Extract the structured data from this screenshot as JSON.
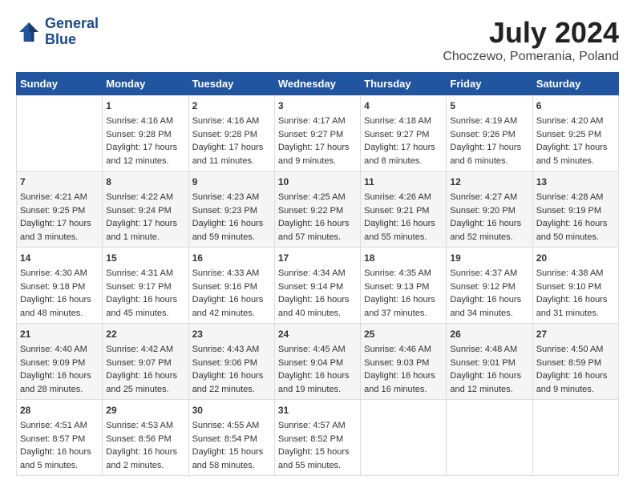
{
  "header": {
    "logo": {
      "line1": "General",
      "line2": "Blue"
    },
    "title": "July 2024",
    "location": "Choczewo, Pomerania, Poland"
  },
  "weekdays": [
    "Sunday",
    "Monday",
    "Tuesday",
    "Wednesday",
    "Thursday",
    "Friday",
    "Saturday"
  ],
  "weeks": [
    [
      {
        "day": "",
        "sunrise": "",
        "sunset": "",
        "daylight": ""
      },
      {
        "day": "1",
        "sunrise": "Sunrise: 4:16 AM",
        "sunset": "Sunset: 9:28 PM",
        "daylight": "Daylight: 17 hours and 12 minutes."
      },
      {
        "day": "2",
        "sunrise": "Sunrise: 4:16 AM",
        "sunset": "Sunset: 9:28 PM",
        "daylight": "Daylight: 17 hours and 11 minutes."
      },
      {
        "day": "3",
        "sunrise": "Sunrise: 4:17 AM",
        "sunset": "Sunset: 9:27 PM",
        "daylight": "Daylight: 17 hours and 9 minutes."
      },
      {
        "day": "4",
        "sunrise": "Sunrise: 4:18 AM",
        "sunset": "Sunset: 9:27 PM",
        "daylight": "Daylight: 17 hours and 8 minutes."
      },
      {
        "day": "5",
        "sunrise": "Sunrise: 4:19 AM",
        "sunset": "Sunset: 9:26 PM",
        "daylight": "Daylight: 17 hours and 6 minutes."
      },
      {
        "day": "6",
        "sunrise": "Sunrise: 4:20 AM",
        "sunset": "Sunset: 9:25 PM",
        "daylight": "Daylight: 17 hours and 5 minutes."
      }
    ],
    [
      {
        "day": "7",
        "sunrise": "Sunrise: 4:21 AM",
        "sunset": "Sunset: 9:25 PM",
        "daylight": "Daylight: 17 hours and 3 minutes."
      },
      {
        "day": "8",
        "sunrise": "Sunrise: 4:22 AM",
        "sunset": "Sunset: 9:24 PM",
        "daylight": "Daylight: 17 hours and 1 minute."
      },
      {
        "day": "9",
        "sunrise": "Sunrise: 4:23 AM",
        "sunset": "Sunset: 9:23 PM",
        "daylight": "Daylight: 16 hours and 59 minutes."
      },
      {
        "day": "10",
        "sunrise": "Sunrise: 4:25 AM",
        "sunset": "Sunset: 9:22 PM",
        "daylight": "Daylight: 16 hours and 57 minutes."
      },
      {
        "day": "11",
        "sunrise": "Sunrise: 4:26 AM",
        "sunset": "Sunset: 9:21 PM",
        "daylight": "Daylight: 16 hours and 55 minutes."
      },
      {
        "day": "12",
        "sunrise": "Sunrise: 4:27 AM",
        "sunset": "Sunset: 9:20 PM",
        "daylight": "Daylight: 16 hours and 52 minutes."
      },
      {
        "day": "13",
        "sunrise": "Sunrise: 4:28 AM",
        "sunset": "Sunset: 9:19 PM",
        "daylight": "Daylight: 16 hours and 50 minutes."
      }
    ],
    [
      {
        "day": "14",
        "sunrise": "Sunrise: 4:30 AM",
        "sunset": "Sunset: 9:18 PM",
        "daylight": "Daylight: 16 hours and 48 minutes."
      },
      {
        "day": "15",
        "sunrise": "Sunrise: 4:31 AM",
        "sunset": "Sunset: 9:17 PM",
        "daylight": "Daylight: 16 hours and 45 minutes."
      },
      {
        "day": "16",
        "sunrise": "Sunrise: 4:33 AM",
        "sunset": "Sunset: 9:16 PM",
        "daylight": "Daylight: 16 hours and 42 minutes."
      },
      {
        "day": "17",
        "sunrise": "Sunrise: 4:34 AM",
        "sunset": "Sunset: 9:14 PM",
        "daylight": "Daylight: 16 hours and 40 minutes."
      },
      {
        "day": "18",
        "sunrise": "Sunrise: 4:35 AM",
        "sunset": "Sunset: 9:13 PM",
        "daylight": "Daylight: 16 hours and 37 minutes."
      },
      {
        "day": "19",
        "sunrise": "Sunrise: 4:37 AM",
        "sunset": "Sunset: 9:12 PM",
        "daylight": "Daylight: 16 hours and 34 minutes."
      },
      {
        "day": "20",
        "sunrise": "Sunrise: 4:38 AM",
        "sunset": "Sunset: 9:10 PM",
        "daylight": "Daylight: 16 hours and 31 minutes."
      }
    ],
    [
      {
        "day": "21",
        "sunrise": "Sunrise: 4:40 AM",
        "sunset": "Sunset: 9:09 PM",
        "daylight": "Daylight: 16 hours and 28 minutes."
      },
      {
        "day": "22",
        "sunrise": "Sunrise: 4:42 AM",
        "sunset": "Sunset: 9:07 PM",
        "daylight": "Daylight: 16 hours and 25 minutes."
      },
      {
        "day": "23",
        "sunrise": "Sunrise: 4:43 AM",
        "sunset": "Sunset: 9:06 PM",
        "daylight": "Daylight: 16 hours and 22 minutes."
      },
      {
        "day": "24",
        "sunrise": "Sunrise: 4:45 AM",
        "sunset": "Sunset: 9:04 PM",
        "daylight": "Daylight: 16 hours and 19 minutes."
      },
      {
        "day": "25",
        "sunrise": "Sunrise: 4:46 AM",
        "sunset": "Sunset: 9:03 PM",
        "daylight": "Daylight: 16 hours and 16 minutes."
      },
      {
        "day": "26",
        "sunrise": "Sunrise: 4:48 AM",
        "sunset": "Sunset: 9:01 PM",
        "daylight": "Daylight: 16 hours and 12 minutes."
      },
      {
        "day": "27",
        "sunrise": "Sunrise: 4:50 AM",
        "sunset": "Sunset: 8:59 PM",
        "daylight": "Daylight: 16 hours and 9 minutes."
      }
    ],
    [
      {
        "day": "28",
        "sunrise": "Sunrise: 4:51 AM",
        "sunset": "Sunset: 8:57 PM",
        "daylight": "Daylight: 16 hours and 5 minutes."
      },
      {
        "day": "29",
        "sunrise": "Sunrise: 4:53 AM",
        "sunset": "Sunset: 8:56 PM",
        "daylight": "Daylight: 16 hours and 2 minutes."
      },
      {
        "day": "30",
        "sunrise": "Sunrise: 4:55 AM",
        "sunset": "Sunset: 8:54 PM",
        "daylight": "Daylight: 15 hours and 58 minutes."
      },
      {
        "day": "31",
        "sunrise": "Sunrise: 4:57 AM",
        "sunset": "Sunset: 8:52 PM",
        "daylight": "Daylight: 15 hours and 55 minutes."
      },
      {
        "day": "",
        "sunrise": "",
        "sunset": "",
        "daylight": ""
      },
      {
        "day": "",
        "sunrise": "",
        "sunset": "",
        "daylight": ""
      },
      {
        "day": "",
        "sunrise": "",
        "sunset": "",
        "daylight": ""
      }
    ]
  ]
}
